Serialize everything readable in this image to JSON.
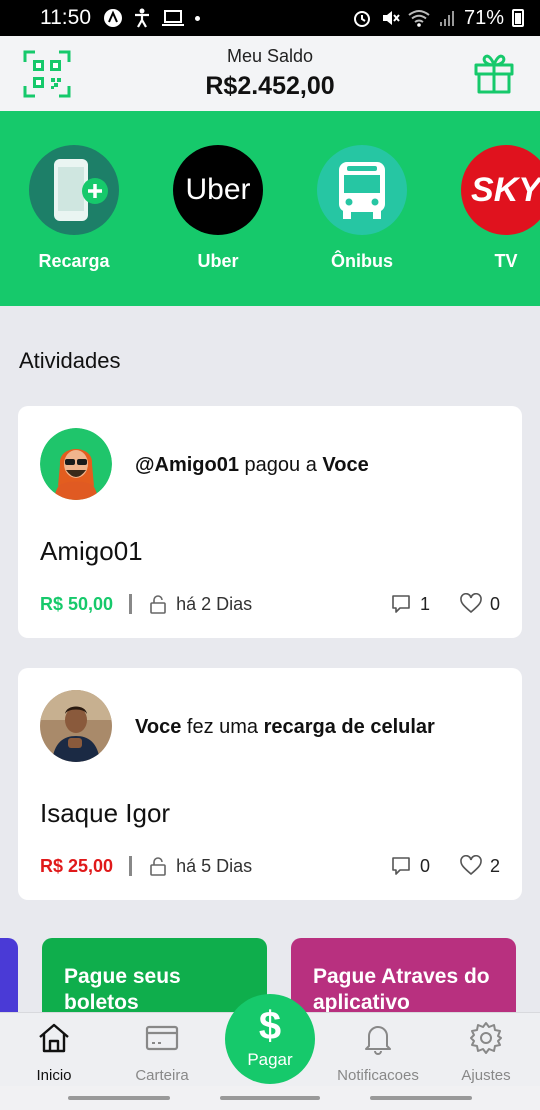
{
  "status_bar": {
    "time": "11:50",
    "battery": "71%"
  },
  "header": {
    "balance_label": "Meu Saldo",
    "balance_value": "R$2.452,00",
    "qr_icon": "qr-code-icon",
    "gift_icon": "gift-icon"
  },
  "shortcuts": [
    {
      "label": "Recarga",
      "icon": "phone-recharge-icon",
      "color": "#1d7f68"
    },
    {
      "label": "Uber",
      "icon": "uber-logo",
      "logo_text": "Uber",
      "color": "#000000"
    },
    {
      "label": "Ônibus",
      "icon": "bus-icon",
      "color": "#26c6a3"
    },
    {
      "label": "TV",
      "icon": "sky-logo",
      "logo_text": "SKY",
      "color": "#e0121e"
    }
  ],
  "activities": {
    "title": "Atividades",
    "items": [
      {
        "user": "@Amigo01",
        "action": " pagou a ",
        "target": "Voce",
        "name": "Amigo01",
        "amount": "R$ 50,00",
        "amount_color": "#16c96b",
        "time_ago": "há 2 Dias",
        "comments": "1",
        "likes": "0"
      },
      {
        "user": "Voce",
        "action": " fez uma ",
        "target": "recarga de celular",
        "name": "Isaque Igor",
        "amount": "R$ 25,00",
        "amount_color": "#e0191a",
        "time_ago": "há 5 Dias",
        "comments": "0",
        "likes": "2"
      }
    ]
  },
  "promos": [
    {
      "title": "Pague seus boletos",
      "color": "#0fae4c"
    },
    {
      "title": "Pague Atraves do aplicativo",
      "color": "#b8307f"
    }
  ],
  "nav": {
    "home": "Inicio",
    "wallet": "Carteira",
    "pay": "Pagar",
    "pay_symbol": "$",
    "notifications": "Notificacoes",
    "settings": "Ajustes"
  }
}
